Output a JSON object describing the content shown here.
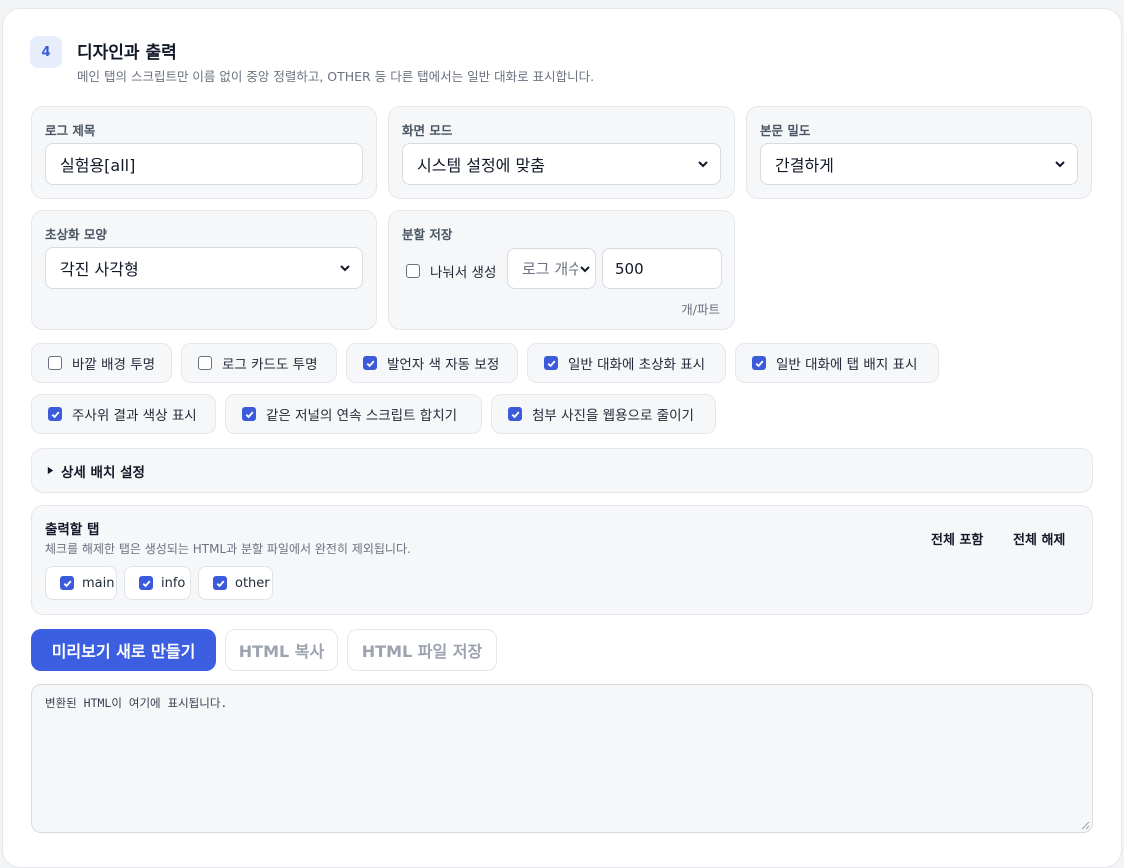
{
  "section": {
    "number": "4",
    "title": "디자인과 출력",
    "description": "메인 탭의 스크립트만 이름 없이 중앙 정렬하고, OTHER 등 다른 탭에서는 일반 대화로 표시합니다."
  },
  "fields": {
    "log_title": {
      "label": "로그 제목",
      "value": "실험용[all]"
    },
    "screen_mode": {
      "label": "화면 모드",
      "value": "시스템 설정에 맞춤"
    },
    "body_density": {
      "label": "본문 밀도",
      "value": "간결하게"
    },
    "avatar_shape": {
      "label": "초상화 모양",
      "value": "각진 사각형"
    },
    "split_save": {
      "label": "분할 저장",
      "checkbox_label": "나눠서 생성",
      "checked": false,
      "unit_select": "로그 개수",
      "count": "500",
      "suffix": "개/파트"
    }
  },
  "options": [
    {
      "label": "바깥 배경 투명",
      "checked": false
    },
    {
      "label": "로그 카드도 투명",
      "checked": false
    },
    {
      "label": "발언자 색 자동 보정",
      "checked": true
    },
    {
      "label": "일반 대화에 초상화 표시",
      "checked": true
    },
    {
      "label": "일반 대화에 탭 배지 표시",
      "checked": true
    },
    {
      "label": "주사위 결과 색상 표시",
      "checked": true
    },
    {
      "label": "같은 저널의 연속 스크립트 합치기",
      "checked": true
    },
    {
      "label": "첨부 사진을 웹용으로 줄이기",
      "checked": true
    }
  ],
  "advanced": {
    "label": "상세 배치 설정"
  },
  "output_tabs": {
    "title": "출력할 탭",
    "description": "체크를 해제한 탭은 생성되는 HTML과 분할 파일에서 완전히 제외됩니다.",
    "select_all": "전체 포함",
    "deselect_all": "전체 해제",
    "tabs": [
      {
        "label": "main",
        "checked": true
      },
      {
        "label": "info",
        "checked": true
      },
      {
        "label": "other",
        "checked": true
      }
    ]
  },
  "actions": {
    "refresh_preview": "미리보기 새로 만들기",
    "copy_html": "HTML 복사",
    "save_html": "HTML 파일 저장"
  },
  "output": {
    "placeholder": "변환된 HTML이 여기에 표시됩니다."
  },
  "colors": {
    "accent": "#3b5fe0",
    "panel_bg": "#f6f7f9",
    "border": "#e5e7eb"
  }
}
